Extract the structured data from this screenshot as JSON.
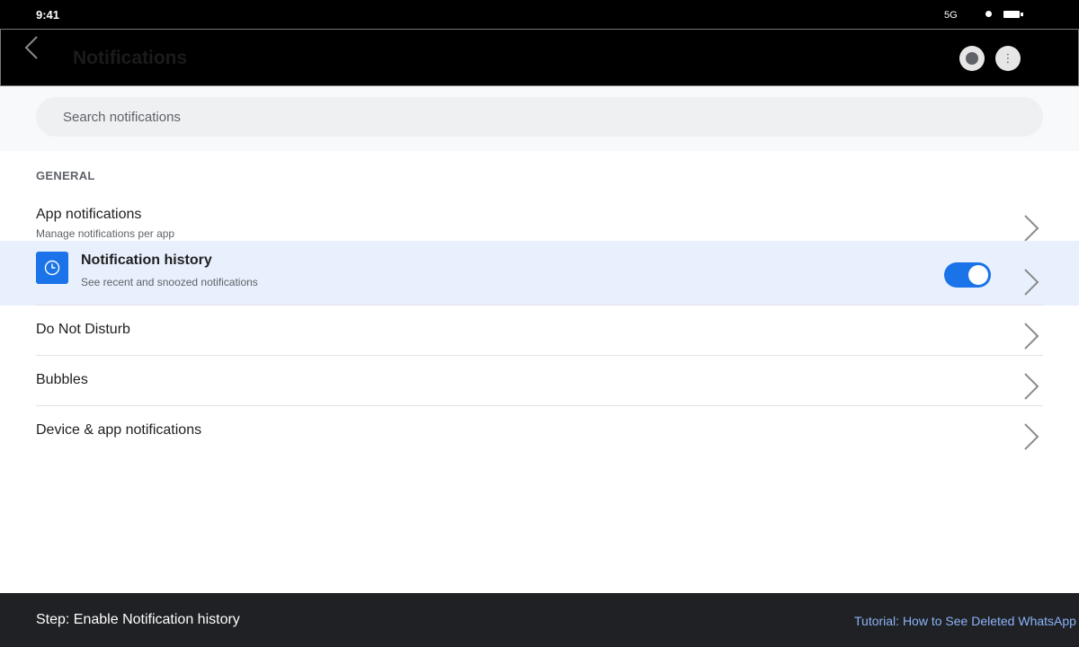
{
  "status_bar": {
    "time": "9:41",
    "network": "5G"
  },
  "app_bar": {
    "title": "Notifications"
  },
  "search": {
    "placeholder": "Search notifications"
  },
  "section": {
    "header": "GENERAL"
  },
  "rows": [
    {
      "title": "App notifications",
      "subtitle": "Manage notifications per app"
    },
    {
      "title": "Notification history",
      "subtitle": "See recent and snoozed notifications",
      "toggle_on": true
    },
    {
      "title": "Do Not Disturb"
    },
    {
      "title": "Bubbles"
    },
    {
      "title": "Device & app notifications"
    }
  ],
  "footer": {
    "step": "Step: Enable Notification history",
    "tutorial_link": "Tutorial: How to See Deleted WhatsApp Messages"
  },
  "colors": {
    "accent": "#1a73e8",
    "highlight": "#e8f0fd",
    "footer_bg": "#202124",
    "link": "#8ab4f8"
  }
}
